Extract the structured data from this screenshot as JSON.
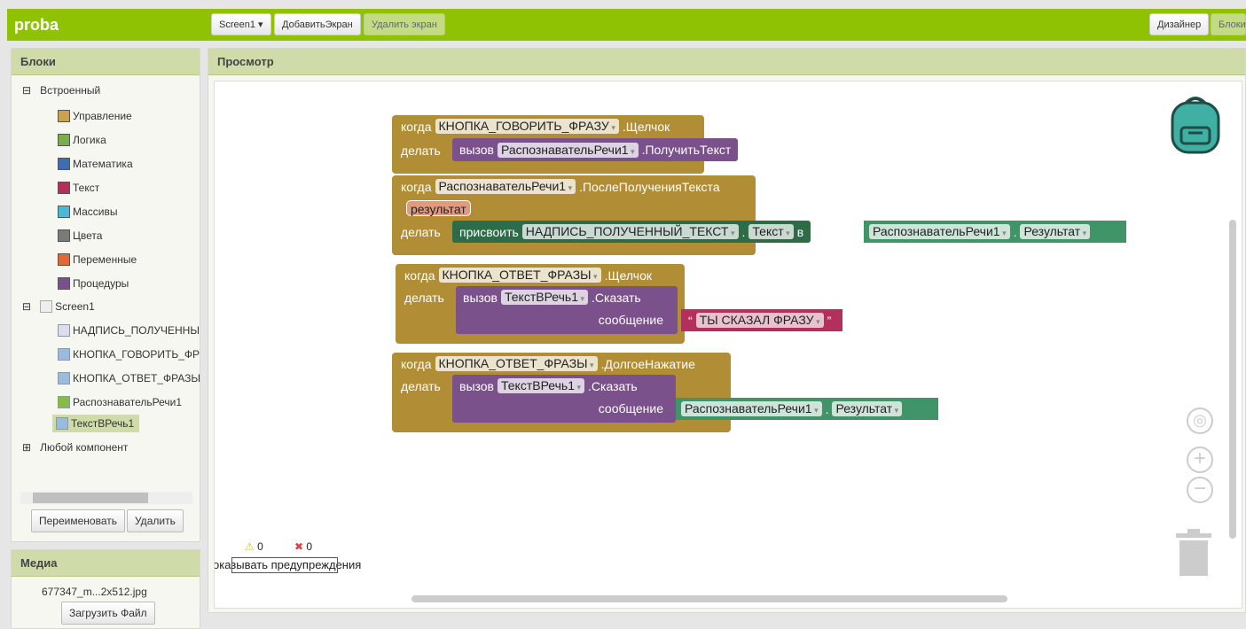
{
  "app": {
    "title": "proba",
    "screen_select": "Screen1",
    "add_screen": "ДобавитьЭкран",
    "remove_screen": "Удалить экран",
    "designer": "Дизайнер",
    "blocks": "Блоки"
  },
  "blocks_panel": {
    "title": "Блоки",
    "builtin": "Встроенный",
    "builtin_items": [
      {
        "label": "Управление",
        "color": "#c8a24c"
      },
      {
        "label": "Логика",
        "color": "#7aae4a"
      },
      {
        "label": "Математика",
        "color": "#3f6db3"
      },
      {
        "label": "Текст",
        "color": "#b4305c"
      },
      {
        "label": "Массивы",
        "color": "#4fb6d8"
      },
      {
        "label": "Цвета",
        "color": "#7a7a7a"
      },
      {
        "label": "Переменные",
        "color": "#e06a35"
      },
      {
        "label": "Процедуры",
        "color": "#7a518a"
      }
    ],
    "screen": "Screen1",
    "components": [
      "НАДПИСЬ_ПОЛУЧЕННЫ",
      "КНОПКА_ГОВОРИТЬ_ФР",
      "КНОПКА_ОТВЕТ_ФРАЗЫ",
      "РаспознавательРечи1",
      "ТекстВРечь1"
    ],
    "any": "Любой компонент",
    "rename": "Переименовать",
    "delete": "Удалить"
  },
  "media": {
    "title": "Медиа",
    "file": "677347_m...2x512.jpg",
    "upload": "Загрузить Файл"
  },
  "viewer": {
    "title": "Просмотр",
    "warnings": "0",
    "errors": "0",
    "show_warnings": "оказывать предупреждения"
  },
  "workspace": {
    "b1": {
      "when": "когда",
      "comp": "КНОПКА_ГОВОРИТЬ_ФРАЗУ",
      "event": ".Щелчок",
      "do": "делать",
      "call": "вызов",
      "target": "РаспознавательРечи1",
      "method": ".ПолучитьТекст"
    },
    "b2": {
      "when": "когда",
      "comp": "РаспознавательРечи1",
      "event": ".ПослеПолученияТекста",
      "param": "результат",
      "do": "делать",
      "set": "присвоить",
      "label": "НАДПИСЬ_ПОЛУЧЕННЫЙ_ТЕКСТ",
      "dot": ".",
      "prop": "Текст",
      "to": "в",
      "src": "РаспознавательРечи1",
      "srcprop": "Результат"
    },
    "b3": {
      "when": "когда",
      "comp": "КНОПКА_ОТВЕТ_ФРАЗЫ",
      "event": ".Щелчок",
      "do": "делать",
      "call": "вызов",
      "target": "ТекстВРечь1",
      "method": ".Сказать",
      "arg": "сообщение",
      "q1": "“",
      "text": "ТЫ СКАЗАЛ ФРАЗУ",
      "q2": "”"
    },
    "b4": {
      "when": "когда",
      "comp": "КНОПКА_ОТВЕТ_ФРАЗЫ",
      "event": ".ДолгоеНажатие",
      "do": "делать",
      "call": "вызов",
      "target": "ТекстВРечь1",
      "method": ".Сказать",
      "arg": "сообщение",
      "src": "РаспознавательРечи1",
      "srcprop": "Результат"
    }
  }
}
